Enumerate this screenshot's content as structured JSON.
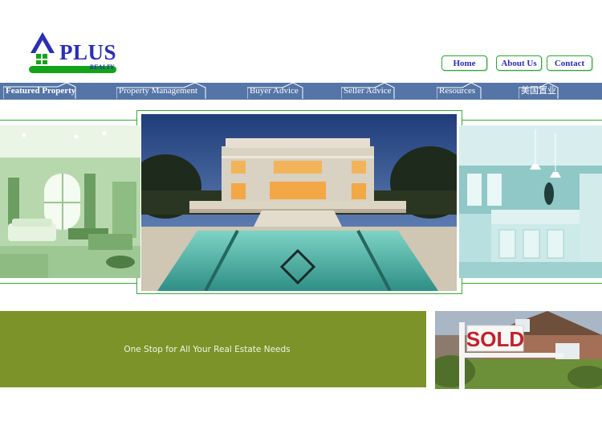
{
  "logo": {
    "name": "PLUS",
    "tagline": "REALTY",
    "colors": {
      "roof": "#2a2fb5",
      "window": "#12a318",
      "bar": "#12a318"
    }
  },
  "top_nav": {
    "home": "Home",
    "about": "About Us",
    "contact": "Contact"
  },
  "main_nav": [
    {
      "label": "Featured Property"
    },
    {
      "label": "Property Management"
    },
    {
      "label": "Buyer Advice"
    },
    {
      "label": "Seller Advice"
    },
    {
      "label": "Resources"
    },
    {
      "label": "美国置业"
    }
  ],
  "hero": {
    "left_image": "living-room-photo",
    "center_image": "mansion-pool-photo",
    "right_image": "kitchen-photo"
  },
  "banner": {
    "text": "One Stop for All Your Real Estate Needs"
  },
  "sold_sign": {
    "text": "SOLD"
  },
  "colors": {
    "nav_bg": "#5575a6",
    "accent_green": "#39a93a",
    "banner_bg": "#7b9328",
    "link_blue": "#2a2fb5"
  }
}
